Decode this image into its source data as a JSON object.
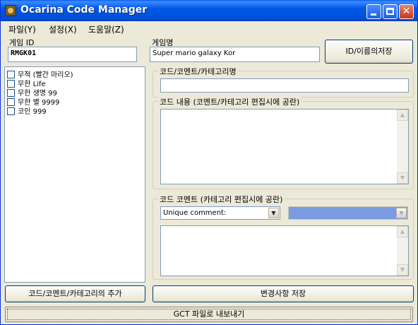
{
  "window": {
    "title": "Ocarina Code Manager"
  },
  "menu": {
    "file": "파일(Y)",
    "settings": "설정(X)",
    "help": "도움말(Z)"
  },
  "game_id": {
    "label": "게임 ID",
    "value": "RMGK01"
  },
  "game_name": {
    "label": "게임명",
    "value": "Super mario galaxy Kor"
  },
  "save_id_name_button": "ID/이름의저장",
  "code_list": [
    {
      "label": "무적 (빨간 마리오)",
      "checked": false
    },
    {
      "label": "무한 Life",
      "checked": false
    },
    {
      "label": "무한 생명 99",
      "checked": false
    },
    {
      "label": "무한 별 9999",
      "checked": false
    },
    {
      "label": "코인 999",
      "checked": false
    }
  ],
  "code_name_group": {
    "title": "코드/코멘트/카테고리명",
    "value": ""
  },
  "code_content_group": {
    "title": "코드 내용 (코멘트/카테고리 편집시에 공란)",
    "value": ""
  },
  "code_comment_group": {
    "title": "코드 코멘트 (카테고리 편집시에 공란)",
    "comment_type": "Unique comment:",
    "secondary": "",
    "value": ""
  },
  "add_button": "코드/코멘트/카테고리의 추가",
  "save_changes_button": "변경사항 저장",
  "export_gct_button": "GCT 파일로 내보내기",
  "colors": {
    "titlebar": "#0058e6",
    "window_bg": "#ece9d8",
    "disabled_combo": "#7b9be0"
  }
}
